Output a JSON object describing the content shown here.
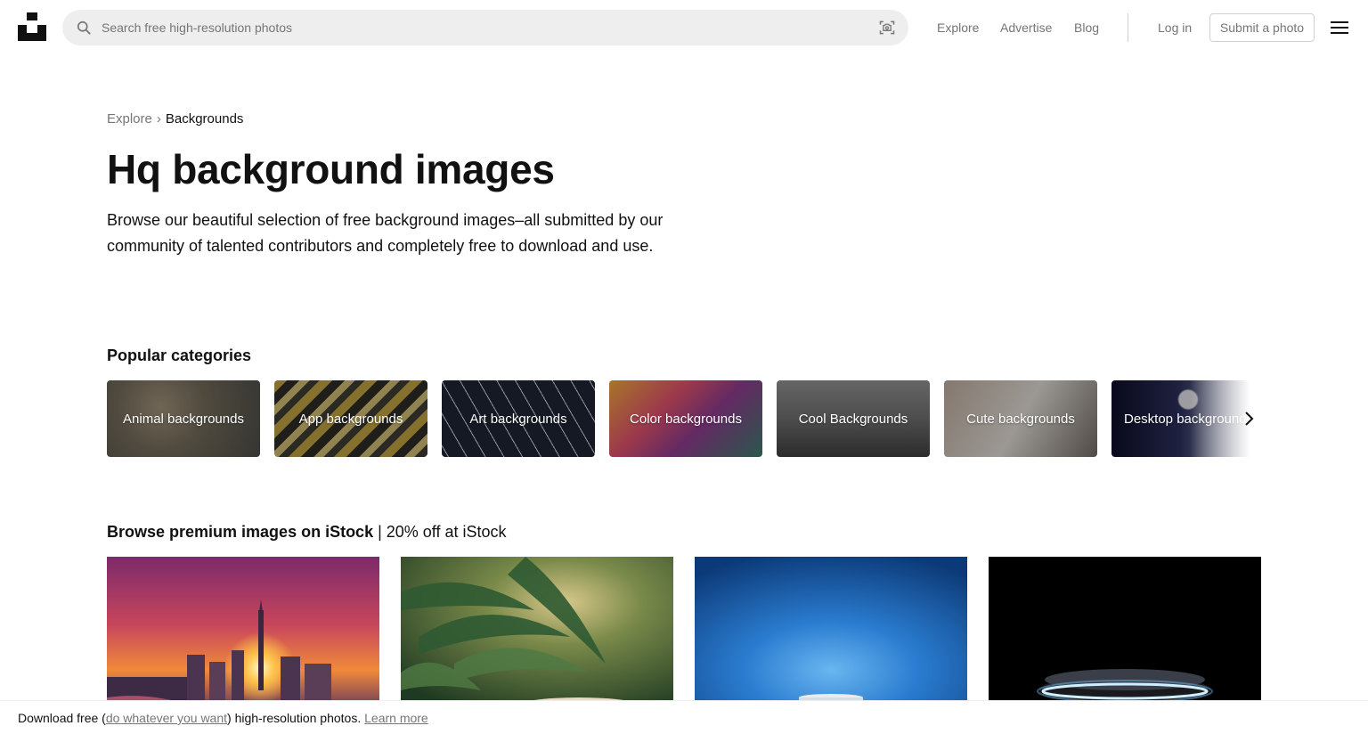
{
  "header": {
    "search_placeholder": "Search free high-resolution photos",
    "nav": [
      "Explore",
      "Advertise",
      "Blog"
    ],
    "login_label": "Log in",
    "submit_label": "Submit a photo"
  },
  "breadcrumb": {
    "parent": "Explore",
    "separator": "›",
    "current": "Backgrounds"
  },
  "hero": {
    "title": "Hq background images",
    "description": "Browse our beautiful selection of free background images–all submitted by our community of talented contributors and completely free to download and use."
  },
  "categories": {
    "title": "Popular categories",
    "items": [
      "Animal backgrounds",
      "App backgrounds",
      "Art backgrounds",
      "Color backgrounds",
      "Cool Backgrounds",
      "Cute backgrounds",
      "Desktop backgrounds"
    ]
  },
  "istock": {
    "title_bold": "Browse premium images on iStock",
    "title_rest": " | 20% off at iStock"
  },
  "banner": {
    "prefix": "Download free (",
    "link": "do whatever you want",
    "suffix": ") high-resolution photos.",
    "learn_more": "Learn more"
  },
  "colors": {
    "text": "#111111",
    "muted": "#767676",
    "search_bg": "#eeeeee",
    "border": "#d1d1d1"
  }
}
